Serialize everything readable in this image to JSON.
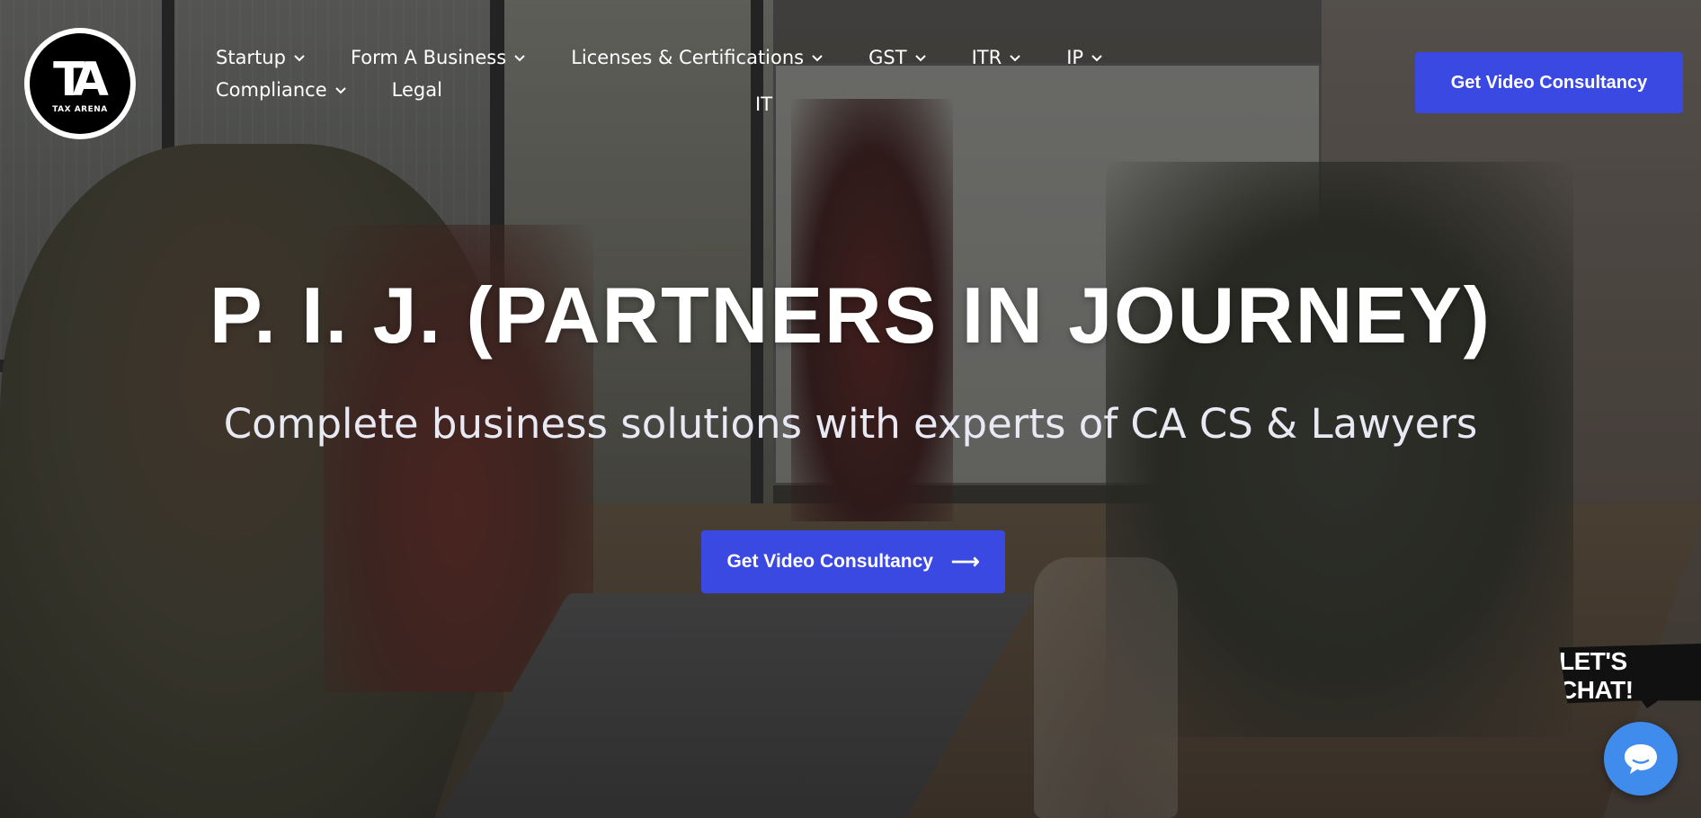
{
  "brand": {
    "logo_mark": "TA",
    "logo_text": "TAX ARENA"
  },
  "nav": {
    "items": [
      {
        "label": "Startup",
        "has_dropdown": true
      },
      {
        "label": "Form A Business",
        "has_dropdown": true
      },
      {
        "label": "Licenses & Certifications",
        "has_dropdown": true
      },
      {
        "label": "GST",
        "has_dropdown": true
      },
      {
        "label": "ITR",
        "has_dropdown": true
      },
      {
        "label": "IP",
        "has_dropdown": true
      },
      {
        "label": "Compliance",
        "has_dropdown": true
      },
      {
        "label": "Legal",
        "has_dropdown": false
      }
    ],
    "row2": {
      "label": "IT"
    }
  },
  "header": {
    "cta_label": "Get Video Consultancy"
  },
  "hero": {
    "title": "P. I. J. (PARTNERS IN JOURNEY)",
    "subtitle": "Complete business solutions with experts of CA CS & Lawyers",
    "cta_label": "Get Video Consultancy",
    "cta_icon": "arrow-right-icon"
  },
  "chat": {
    "bubble_text": "LET'S CHAT!",
    "icon": "chat-icon"
  },
  "colors": {
    "accent": "#3b49e3",
    "chat_blue": "#3f8cec"
  }
}
